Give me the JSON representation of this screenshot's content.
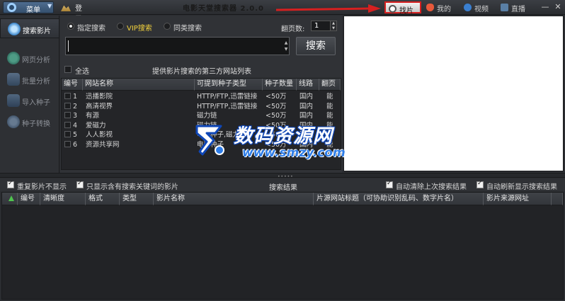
{
  "titlebar": {
    "menu_label": "菜单",
    "login_label": "登录",
    "app_title": "电影天堂搜索器 2.0.0",
    "buttons": {
      "find": "找片",
      "mine": "我的",
      "video": "视频",
      "live": "直播"
    },
    "min": "—",
    "close": "✕",
    "highlight_color": "#d62020"
  },
  "sidebar": {
    "items": [
      {
        "label": "搜索影片",
        "icon": "search-disc-icon",
        "active": true
      },
      {
        "label": "网页分析",
        "icon": "web-analysis-icon"
      },
      {
        "label": "批量分析",
        "icon": "batch-analysis-icon"
      },
      {
        "label": "导入种子",
        "icon": "import-seed-icon"
      },
      {
        "label": "种子转换",
        "icon": "seed-convert-icon"
      }
    ]
  },
  "search": {
    "modes": [
      {
        "label": "指定搜索",
        "selected": true
      },
      {
        "label": "VIP搜索",
        "selected": false
      },
      {
        "label": "同类搜索",
        "selected": false
      }
    ],
    "pages_label": "翻页数:",
    "pages_value": "1",
    "query": "",
    "button": "搜索",
    "select_all": "全选",
    "sites_caption": "提供影片搜索的第三方网站列表"
  },
  "site_table": {
    "headers": [
      "编号",
      "网站名称",
      "可提到种子类型",
      "种子数量",
      "线路",
      "翻页"
    ],
    "rows": [
      [
        "1",
        "迅播影院",
        "HTTP/FTP,迅雷链接",
        "<50万",
        "国内",
        "能"
      ],
      [
        "2",
        "高清视界",
        "HTTP/FTP,迅雷链接",
        "<50万",
        "国内",
        "能"
      ],
      [
        "3",
        "有源",
        "磁力链",
        "<50万",
        "国内",
        "能"
      ],
      [
        "4",
        "爱磁力",
        "磁力链",
        "<50万",
        "国内",
        "能"
      ],
      [
        "5",
        "人人影视",
        "电驴种子,磁力链",
        "<50万",
        "国内",
        "能"
      ],
      [
        "6",
        "资源共享网",
        "电驴种子",
        "<50万",
        "国内",
        "能"
      ]
    ]
  },
  "options": {
    "dedupe": "重复影片不显示",
    "keyword_only": "只显示含有搜索关键词的影片",
    "results_title": "搜索结果",
    "auto_clear": "自动清除上次搜索结果",
    "auto_show": "自动刷新显示搜索结果"
  },
  "results_table": {
    "headers": [
      "编号",
      "清晰度",
      "格式",
      "类型",
      "影片名称",
      "片源网站标题（可协助识别乱码、数字片名）",
      "影片来源网址"
    ]
  },
  "watermark": {
    "main": "数码资源网",
    "url": "www.smzy.com"
  }
}
